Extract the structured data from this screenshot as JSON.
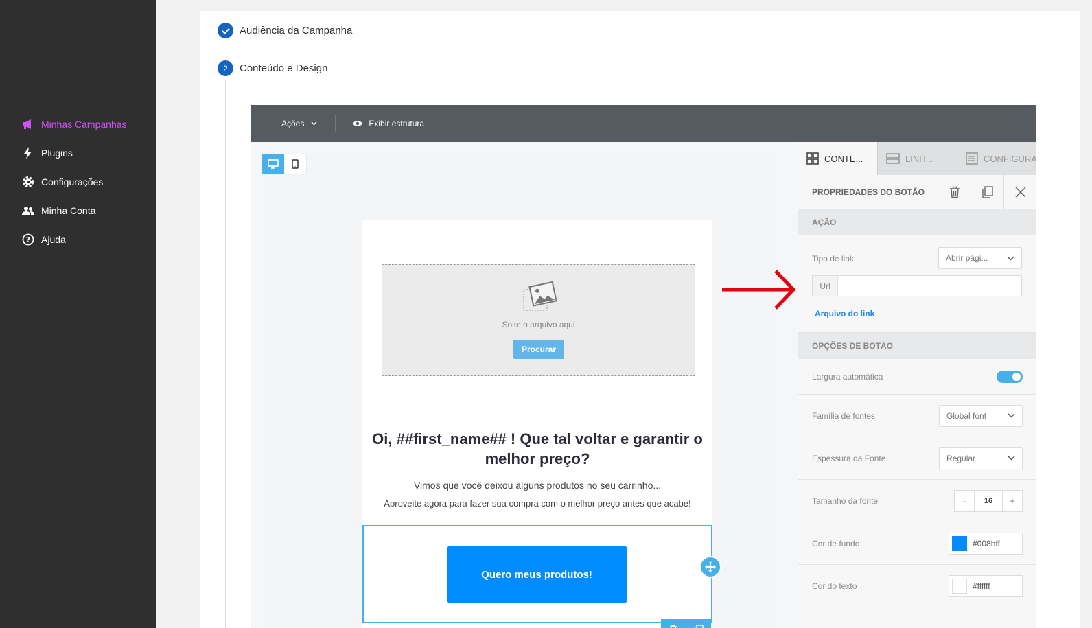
{
  "sidebar": {
    "items": [
      {
        "label": "Minhas Campanhas",
        "icon": "megaphone-icon",
        "active": true
      },
      {
        "label": "Plugins",
        "icon": "lightning-icon"
      },
      {
        "label": "Configurações",
        "icon": "gear-icon"
      },
      {
        "label": "Minha Conta",
        "icon": "users-icon"
      },
      {
        "label": "Ajuda",
        "icon": "help-circle-icon"
      }
    ]
  },
  "steps": [
    {
      "label": "Audiência da Campanha",
      "state": "done"
    },
    {
      "number": "2",
      "label": "Conteúdo e Design",
      "state": "current"
    }
  ],
  "toolbar": {
    "actions_label": "Ações",
    "structure_label": "Exibir estrutura"
  },
  "email": {
    "drop_text": "Solte o arquivo aqui",
    "browse_label": "Procurar",
    "headline": "Oi, ##first_name## ! Que tal voltar e garantir o melhor preço?",
    "paragraph1": "Vimos que você deixou alguns produtos no seu carrinho...",
    "paragraph2": "Aproveite agora para fazer sua compra com o melhor preço antes que acabe!",
    "cta_label": "Quero meus produtos!"
  },
  "panel": {
    "tabs": [
      "CONTE...",
      "LINH...",
      "CONFIGURA..."
    ],
    "title": "PROPRIEDADES DO BOTÃO",
    "section_action": "AÇÃO",
    "link_type_label": "Tipo de link",
    "link_type_value": "Abrir pági...",
    "url_label": "Url",
    "url_value": "",
    "link_file": "Arquivo do link",
    "section_options": "OPÇÕES DE BOTÃO",
    "auto_width_label": "Largura automática",
    "auto_width_on": true,
    "font_family_label": "Família de fontes",
    "font_family_value": "Global font",
    "font_weight_label": "Espessura da Fonte",
    "font_weight_value": "Regular",
    "font_size_label": "Tamanho da fonte",
    "font_size_value": "16",
    "minus": "-",
    "plus": "+",
    "bg_color_label": "Cor de fundo",
    "bg_color_value": "#008bff",
    "text_color_label": "Cor do texto",
    "text_color_value": "#ffffff"
  },
  "colors": {
    "accent": "#48b0e8",
    "active_nav": "#d24ff5",
    "cta": "#008bff",
    "annotation_arrow": "#e3000f"
  }
}
